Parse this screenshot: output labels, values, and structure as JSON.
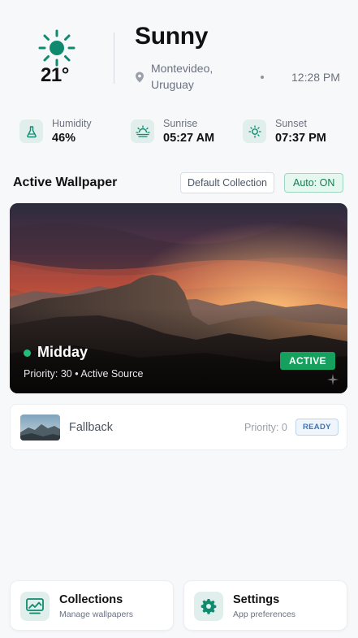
{
  "weather": {
    "icon": "sun-icon",
    "temperature": "21°",
    "condition": "Sunny",
    "location": "Montevideo, Uruguay",
    "time": "12:28 PM",
    "accent_color": "#0f8a6f"
  },
  "stats": [
    {
      "icon": "flask-icon",
      "label": "Humidity",
      "value": "46%"
    },
    {
      "icon": "sunrise-icon",
      "label": "Sunrise",
      "value": "05:27 AM"
    },
    {
      "icon": "sunset-icon",
      "label": "Sunset",
      "value": "07:37 PM"
    }
  ],
  "wallpaper": {
    "section_title": "Active Wallpaper",
    "collection_button": "Default Collection",
    "auto_button": "Auto: ON",
    "active": {
      "title": "Midday",
      "subtitle": "Priority: 30 • Active Source",
      "badge": "ACTIVE",
      "status_color": "#1fbf7a"
    },
    "fallback": {
      "title": "Fallback",
      "priority": "Priority: 0",
      "badge": "READY"
    }
  },
  "nav": [
    {
      "icon": "image-icon",
      "title": "Collections",
      "subtitle": "Manage wallpapers"
    },
    {
      "icon": "gear-icon",
      "title": "Settings",
      "subtitle": "App preferences"
    }
  ]
}
